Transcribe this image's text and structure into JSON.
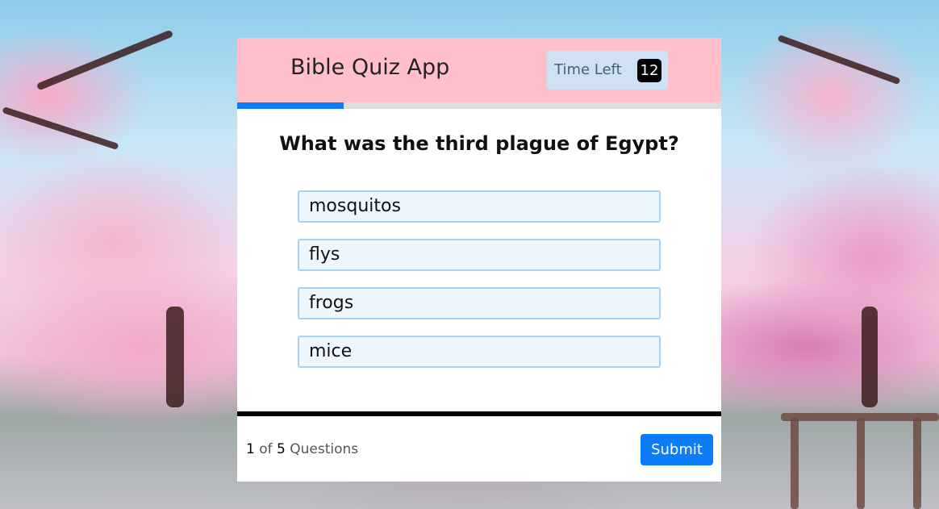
{
  "app": {
    "title": "Bible Quiz App"
  },
  "timer": {
    "label": "Time Left",
    "value": "12"
  },
  "progress": {
    "fraction": 0.22
  },
  "quiz": {
    "question": "What was the third plague of Egypt?",
    "options": [
      "mosquitos",
      "flys",
      "frogs",
      "mice"
    ]
  },
  "footer": {
    "current": "1",
    "of_label": "of",
    "total": "5",
    "questions_label": "Questions",
    "submit_label": "Submit"
  },
  "colors": {
    "header_bg": "#ffc0cb",
    "accent": "#0d7cf7",
    "timer_bg": "#cfe2f3",
    "option_bg": "#eef7fd",
    "option_border": "#a7d3f3"
  }
}
